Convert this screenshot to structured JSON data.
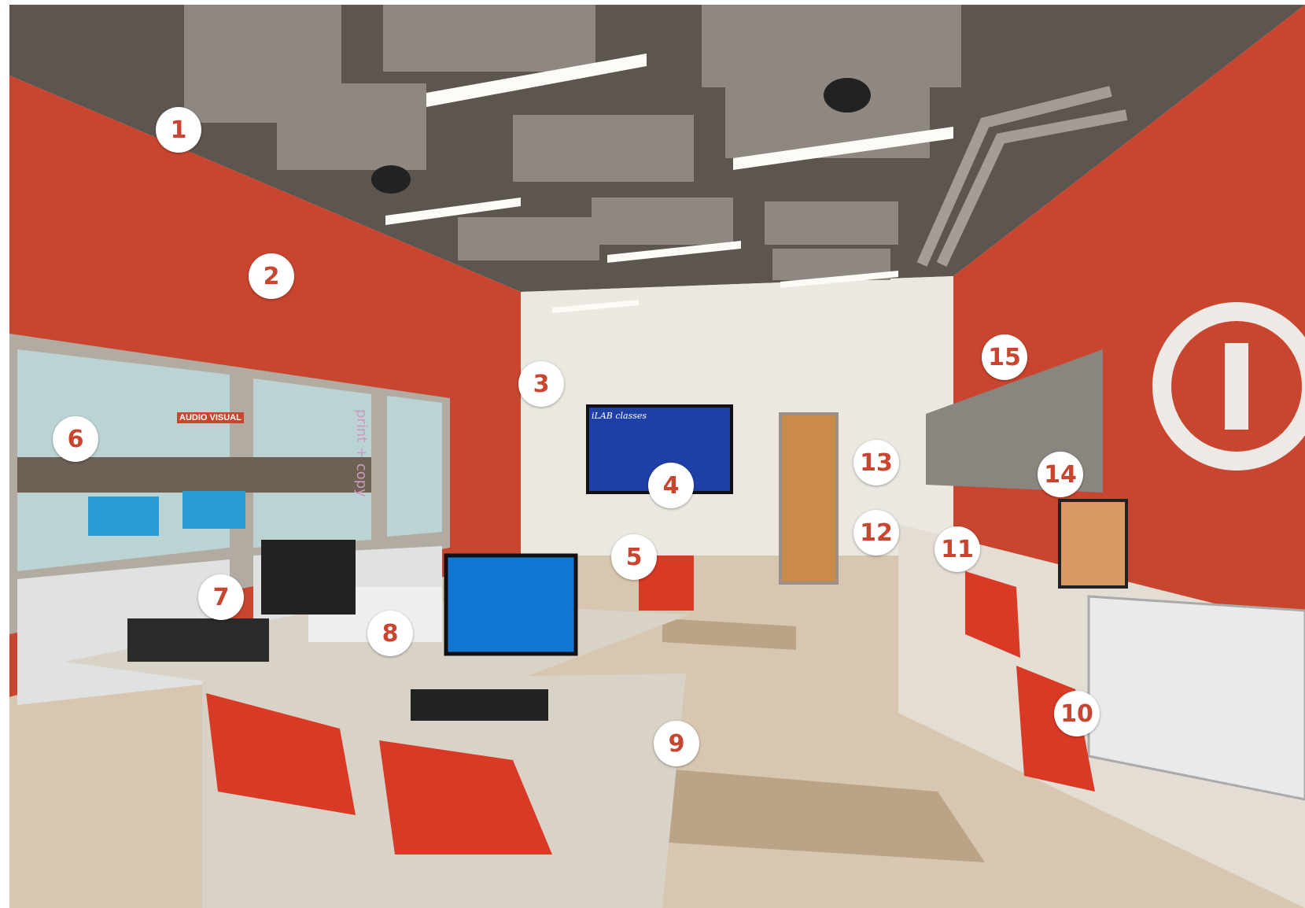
{
  "photo": {
    "wall_text": "print + copy",
    "sign_text": "AUDIO VISUAL",
    "screen_title": "iLAB classes"
  },
  "callouts": [
    {
      "id": "callout-1",
      "label": "1"
    },
    {
      "id": "callout-2",
      "label": "2"
    },
    {
      "id": "callout-3",
      "label": "3"
    },
    {
      "id": "callout-4",
      "label": "4"
    },
    {
      "id": "callout-5",
      "label": "5"
    },
    {
      "id": "callout-6",
      "label": "6"
    },
    {
      "id": "callout-7",
      "label": "7"
    },
    {
      "id": "callout-8",
      "label": "8"
    },
    {
      "id": "callout-9",
      "label": "9"
    },
    {
      "id": "callout-10",
      "label": "10"
    },
    {
      "id": "callout-11",
      "label": "11"
    },
    {
      "id": "callout-12",
      "label": "12"
    },
    {
      "id": "callout-13",
      "label": "13"
    },
    {
      "id": "callout-14",
      "label": "14"
    },
    {
      "id": "callout-15",
      "label": "15"
    }
  ],
  "colors": {
    "accent_wall": "#c8452f",
    "ceiling": "#5d5550",
    "floor": "#d8c7b0",
    "callout_bg": "#ffffff",
    "callout_text": "#c8452f"
  }
}
